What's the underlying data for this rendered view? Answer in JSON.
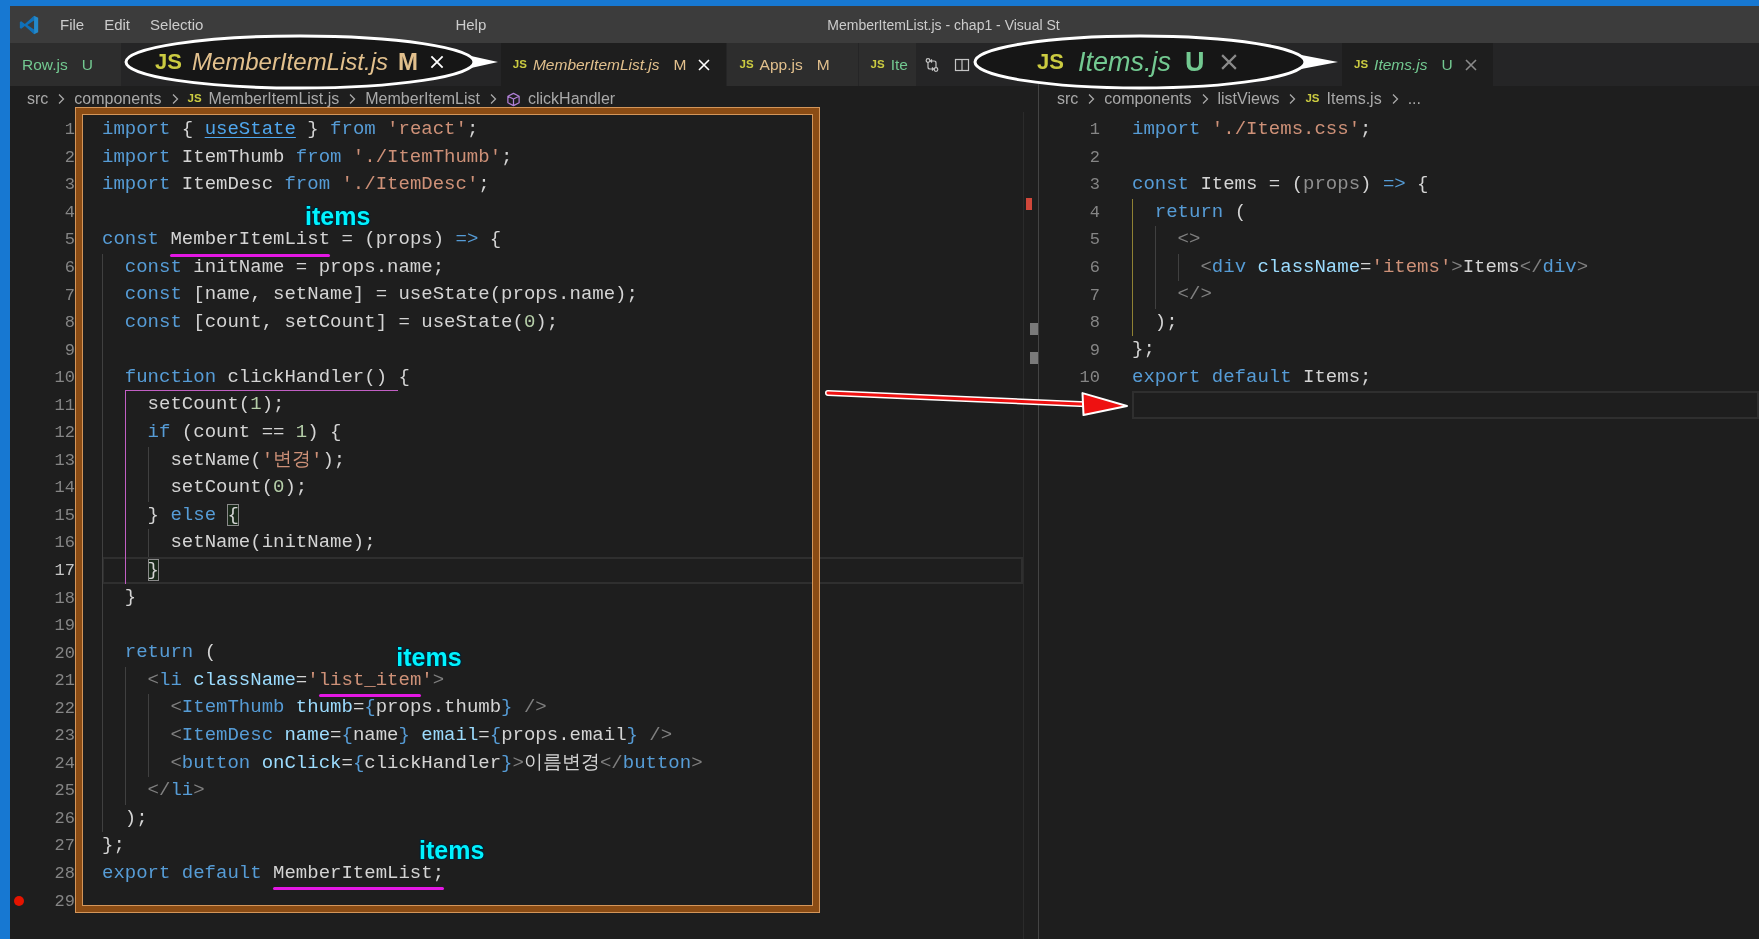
{
  "title_bar": {
    "menu": [
      {
        "label": "File"
      },
      {
        "label": "Edit"
      },
      {
        "label": "Selectio"
      },
      {
        "label": "Help"
      }
    ],
    "title": "MemberItemList.js - chap1 - Visual St"
  },
  "editor_groups": [
    {
      "focused": true,
      "tabs": [
        {
          "label": "Row.js",
          "badge": "U",
          "kind": "untracked",
          "selected": false,
          "preview": false
        },
        {
          "icon": "JS",
          "label": "MemberItemList.js",
          "badge": "M",
          "kind": "modified",
          "selected": true,
          "preview": true
        },
        {
          "icon": "JS",
          "label": "App.js",
          "badge": "M",
          "kind": "modified",
          "selected": false,
          "preview": false
        },
        {
          "icon": "JS",
          "label": "Ite",
          "kind": "untracked",
          "selected": false,
          "preview": false
        }
      ],
      "breadcrumb": [
        {
          "kind": "folder",
          "label": "src"
        },
        {
          "kind": "folder",
          "label": "components"
        },
        {
          "kind": "file",
          "icon": "JS",
          "label": "MemberItemList.js"
        },
        {
          "kind": "symbol",
          "label": "MemberItemList"
        },
        {
          "kind": "method",
          "label": "clickHandler"
        }
      ],
      "overview_marks": [
        {
          "color": "#d0473a"
        },
        {
          "color": "#7a7a7a"
        },
        {
          "color": "#7a7a7a"
        }
      ],
      "lines": [
        {
          "n": "1",
          "current": false,
          "breakpoint": false,
          "active_guide": false,
          "tokens": [
            {
              "text": "import",
              "kind": "kw"
            },
            {
              "text": " { ",
              "kind": "txt"
            },
            {
              "text": "useState",
              "kind": "link"
            },
            {
              "text": " } ",
              "kind": "txt"
            },
            {
              "text": "from",
              "kind": "kw"
            },
            {
              "text": " 'react'",
              "kind": "str"
            },
            {
              "text": ";",
              "kind": "txt"
            }
          ]
        },
        {
          "n": "2",
          "current": false,
          "breakpoint": false,
          "active_guide": false,
          "tokens": [
            {
              "text": "import",
              "kind": "kw"
            },
            {
              "text": " ItemThumb ",
              "kind": "txt"
            },
            {
              "text": "from",
              "kind": "kw"
            },
            {
              "text": " './ItemThumb'",
              "kind": "str"
            },
            {
              "text": ";",
              "kind": "txt"
            }
          ]
        },
        {
          "n": "3",
          "current": false,
          "breakpoint": false,
          "active_guide": false,
          "tokens": [
            {
              "text": "import",
              "kind": "kw"
            },
            {
              "text": " ItemDesc ",
              "kind": "txt"
            },
            {
              "text": "from",
              "kind": "kw"
            },
            {
              "text": " './ItemDesc'",
              "kind": "str"
            },
            {
              "text": ";",
              "kind": "txt"
            }
          ]
        },
        {
          "n": "4",
          "current": false,
          "breakpoint": false,
          "active_guide": false
        },
        {
          "n": "5",
          "current": false,
          "breakpoint": false,
          "active_guide": false,
          "tokens": [
            {
              "text": "const ",
              "kind": "kw"
            },
            {
              "text": "MemberItemList",
              "kind": "txt",
              "note": "items"
            },
            {
              "text": " = (props) ",
              "kind": "txt"
            },
            {
              "text": "=>",
              "kind": "kw"
            },
            {
              "text": " {",
              "kind": "txt"
            }
          ]
        },
        {
          "n": "6",
          "current": false,
          "breakpoint": false,
          "active_guide": false,
          "tokens": [
            {
              "text": "  const",
              "kind": "kw"
            },
            {
              "text": " initName = props.name;",
              "kind": "txt"
            }
          ]
        },
        {
          "n": "7",
          "current": false,
          "breakpoint": false,
          "active_guide": false,
          "tokens": [
            {
              "text": "  const",
              "kind": "kw"
            },
            {
              "text": " [name, setName] = useState(props.name);",
              "kind": "txt"
            }
          ]
        },
        {
          "n": "8",
          "current": false,
          "breakpoint": false,
          "active_guide": false,
          "tokens": [
            {
              "text": "  const",
              "kind": "kw"
            },
            {
              "text": " [count, setCount] = useState(",
              "kind": "txt"
            },
            {
              "text": "0",
              "kind": "num"
            },
            {
              "text": ");",
              "kind": "txt"
            }
          ]
        },
        {
          "n": "9",
          "current": false,
          "breakpoint": false,
          "active_guide": false
        },
        {
          "n": "10",
          "current": false,
          "breakpoint": false,
          "active_guide": false,
          "tokens": [
            {
              "text": "  function",
              "kind": "kw"
            },
            {
              "text": " clickHandler() {",
              "kind": "txt"
            }
          ]
        },
        {
          "n": "11",
          "current": false,
          "breakpoint": false,
          "active_guide": true,
          "tokens": [
            {
              "text": "    setCount(",
              "kind": "txt"
            },
            {
              "text": "1",
              "kind": "num"
            },
            {
              "text": ");",
              "kind": "txt"
            }
          ]
        },
        {
          "n": "12",
          "current": false,
          "breakpoint": false,
          "active_guide": true,
          "tokens": [
            {
              "text": "    if",
              "kind": "kw"
            },
            {
              "text": " (count == ",
              "kind": "txt"
            },
            {
              "text": "1",
              "kind": "num"
            },
            {
              "text": ") {",
              "kind": "txt"
            }
          ]
        },
        {
          "n": "13",
          "current": false,
          "breakpoint": false,
          "active_guide": true,
          "tokens": [
            {
              "text": "      setName(",
              "kind": "txt"
            },
            {
              "text": "'변경'",
              "kind": "str"
            },
            {
              "text": ");",
              "kind": "txt"
            }
          ]
        },
        {
          "n": "14",
          "current": false,
          "breakpoint": false,
          "active_guide": true,
          "tokens": [
            {
              "text": "      setCount(",
              "kind": "txt"
            },
            {
              "text": "0",
              "kind": "num"
            },
            {
              "text": ");",
              "kind": "txt"
            }
          ]
        },
        {
          "n": "15",
          "current": false,
          "breakpoint": false,
          "active_guide": true,
          "tokens": [
            {
              "text": "    } ",
              "kind": "txt"
            },
            {
              "text": "else ",
              "kind": "kw"
            },
            {
              "text": "{",
              "kind": "match"
            }
          ]
        },
        {
          "n": "16",
          "current": false,
          "breakpoint": false,
          "active_guide": true,
          "tokens": [
            {
              "text": "      setName(initName);",
              "kind": "txt"
            }
          ]
        },
        {
          "n": "17",
          "current": true,
          "breakpoint": false,
          "active_guide": true,
          "tokens": [
            {
              "text": "    }",
              "kind": "match"
            }
          ]
        },
        {
          "n": "18",
          "current": false,
          "breakpoint": false,
          "active_guide": false,
          "tokens": [
            {
              "text": "  }",
              "kind": "txt"
            }
          ]
        },
        {
          "n": "19",
          "current": false,
          "breakpoint": false,
          "active_guide": false
        },
        {
          "n": "20",
          "current": false,
          "breakpoint": false,
          "active_guide": false,
          "tokens": [
            {
              "text": "  return",
              "kind": "kw"
            },
            {
              "text": " (",
              "kind": "txt"
            }
          ]
        },
        {
          "n": "21",
          "current": false,
          "breakpoint": false,
          "active_guide": false,
          "tokens": [
            {
              "text": "    <",
              "kind": "punct"
            },
            {
              "text": "li",
              "kind": "kw"
            },
            {
              "text": " className",
              "kind": "attr"
            },
            {
              "text": "=",
              "kind": "txt"
            },
            {
              "text": "'",
              "kind": "str"
            },
            {
              "text": "list_item",
              "kind": "str",
              "note": "items"
            },
            {
              "text": "'",
              "kind": "str"
            },
            {
              "text": ">",
              "kind": "punct"
            }
          ]
        },
        {
          "n": "22",
          "current": false,
          "breakpoint": false,
          "active_guide": false,
          "tokens": [
            {
              "text": "      <",
              "kind": "punct"
            },
            {
              "text": "ItemThumb",
              "kind": "kw"
            },
            {
              "text": " thumb",
              "kind": "attr"
            },
            {
              "text": "=",
              "kind": "txt"
            },
            {
              "text": "{",
              "kind": "kw"
            },
            {
              "text": "props.thumb",
              "kind": "txt"
            },
            {
              "text": "}",
              "kind": "kw"
            },
            {
              "text": " />",
              "kind": "punct"
            }
          ]
        },
        {
          "n": "23",
          "current": false,
          "breakpoint": false,
          "active_guide": false,
          "tokens": [
            {
              "text": "      <",
              "kind": "punct"
            },
            {
              "text": "ItemDesc",
              "kind": "kw"
            },
            {
              "text": " name",
              "kind": "attr"
            },
            {
              "text": "=",
              "kind": "txt"
            },
            {
              "text": "{",
              "kind": "kw"
            },
            {
              "text": "name",
              "kind": "txt"
            },
            {
              "text": "}",
              "kind": "kw"
            },
            {
              "text": " email",
              "kind": "attr"
            },
            {
              "text": "=",
              "kind": "txt"
            },
            {
              "text": "{",
              "kind": "kw"
            },
            {
              "text": "props.email",
              "kind": "txt"
            },
            {
              "text": "}",
              "kind": "kw"
            },
            {
              "text": " />",
              "kind": "punct"
            }
          ]
        },
        {
          "n": "24",
          "current": false,
          "breakpoint": false,
          "active_guide": false,
          "tokens": [
            {
              "text": "      <",
              "kind": "punct"
            },
            {
              "text": "button",
              "kind": "kw"
            },
            {
              "text": " onClick",
              "kind": "attr"
            },
            {
              "text": "=",
              "kind": "txt"
            },
            {
              "text": "{",
              "kind": "kw"
            },
            {
              "text": "clickHandler",
              "kind": "txt"
            },
            {
              "text": "}",
              "kind": "kw"
            },
            {
              "text": ">",
              "kind": "punct"
            },
            {
              "text": "이름변경",
              "kind": "txt"
            },
            {
              "text": "</",
              "kind": "punct"
            },
            {
              "text": "button",
              "kind": "kw"
            },
            {
              "text": ">",
              "kind": "punct"
            }
          ]
        },
        {
          "n": "25",
          "current": false,
          "breakpoint": false,
          "active_guide": false,
          "tokens": [
            {
              "text": "    </",
              "kind": "punct"
            },
            {
              "text": "li",
              "kind": "kw"
            },
            {
              "text": ">",
              "kind": "punct"
            }
          ]
        },
        {
          "n": "26",
          "current": false,
          "breakpoint": false,
          "active_guide": false,
          "tokens": [
            {
              "text": "  );",
              "kind": "txt"
            }
          ]
        },
        {
          "n": "27",
          "current": false,
          "breakpoint": false,
          "active_guide": false,
          "tokens": [
            {
              "text": "};",
              "kind": "txt"
            }
          ]
        },
        {
          "n": "28",
          "current": false,
          "breakpoint": false,
          "active_guide": false,
          "tokens": [
            {
              "text": "export default ",
              "kind": "kw"
            },
            {
              "text": "MemberItemList;",
              "kind": "txt",
              "note": "items"
            }
          ]
        },
        {
          "n": "29",
          "current": false,
          "breakpoint": true,
          "active_guide": false
        }
      ]
    },
    {
      "focused": false,
      "tabs": [
        {
          "icon": "JS",
          "label": "Items.js",
          "badge": "U",
          "kind": "untracked",
          "selected": true,
          "preview": true
        }
      ],
      "breadcrumb": [
        {
          "kind": "folder",
          "label": "src"
        },
        {
          "kind": "folder",
          "label": "components"
        },
        {
          "kind": "folder",
          "label": "listViews"
        },
        {
          "kind": "file",
          "icon": "JS",
          "label": "Items.js"
        },
        {
          "kind": "more",
          "label": "..."
        }
      ],
      "lines": [
        {
          "n": "1",
          "current": false,
          "breakpoint": false,
          "active_guide": false,
          "tokens": [
            {
              "text": "import",
              "kind": "kw"
            },
            {
              "text": " './Items.css'",
              "kind": "str"
            },
            {
              "text": ";",
              "kind": "txt"
            }
          ]
        },
        {
          "n": "2",
          "current": false,
          "breakpoint": false,
          "active_guide": false
        },
        {
          "n": "3",
          "current": false,
          "breakpoint": false,
          "active_guide": false,
          "tokens": [
            {
              "text": "const",
              "kind": "kw"
            },
            {
              "text": " Items = (",
              "kind": "txt"
            },
            {
              "text": "props",
              "kind": "faded"
            },
            {
              "text": ") ",
              "kind": "txt"
            },
            {
              "text": "=>",
              "kind": "kw"
            },
            {
              "text": " {",
              "kind": "txt"
            }
          ]
        },
        {
          "n": "4",
          "current": false,
          "breakpoint": false,
          "active_guide": true,
          "tokens": [
            {
              "text": "  return",
              "kind": "kw"
            },
            {
              "text": " (",
              "kind": "txt"
            }
          ]
        },
        {
          "n": "5",
          "current": false,
          "breakpoint": false,
          "active_guide": true,
          "tokens": [
            {
              "text": "    <>",
              "kind": "punct"
            }
          ]
        },
        {
          "n": "6",
          "current": false,
          "breakpoint": false,
          "active_guide": true,
          "tokens": [
            {
              "text": "      <",
              "kind": "punct"
            },
            {
              "text": "div",
              "kind": "kw"
            },
            {
              "text": " className",
              "kind": "attr"
            },
            {
              "text": "=",
              "kind": "txt"
            },
            {
              "text": "'items'",
              "kind": "str"
            },
            {
              "text": ">",
              "kind": "punct"
            },
            {
              "text": "Items",
              "kind": "txt"
            },
            {
              "text": "</",
              "kind": "punct"
            },
            {
              "text": "div",
              "kind": "kw"
            },
            {
              "text": ">",
              "kind": "punct"
            }
          ]
        },
        {
          "n": "7",
          "current": false,
          "breakpoint": false,
          "active_guide": true,
          "tokens": [
            {
              "text": "    </>",
              "kind": "punct"
            }
          ]
        },
        {
          "n": "8",
          "current": false,
          "breakpoint": false,
          "active_guide": true,
          "tokens": [
            {
              "text": "  );",
              "kind": "txt"
            }
          ]
        },
        {
          "n": "9",
          "current": false,
          "breakpoint": false,
          "active_guide": false,
          "tokens": [
            {
              "text": "};",
              "kind": "txt"
            }
          ]
        },
        {
          "n": "10",
          "current": false,
          "breakpoint": false,
          "active_guide": false,
          "tokens": [
            {
              "text": "export default",
              "kind": "kw"
            },
            {
              "text": " Items;",
              "kind": "txt"
            }
          ]
        },
        {
          "current": true,
          "breakpoint": false,
          "active_guide": false
        }
      ]
    }
  ],
  "callouts": [
    {
      "icon": "JS",
      "label": "MemberItemList.js",
      "badge": "M",
      "kind": "modified"
    },
    {
      "icon": "JS",
      "label": "Items.js",
      "badge": "U",
      "kind": "untracked"
    }
  ]
}
